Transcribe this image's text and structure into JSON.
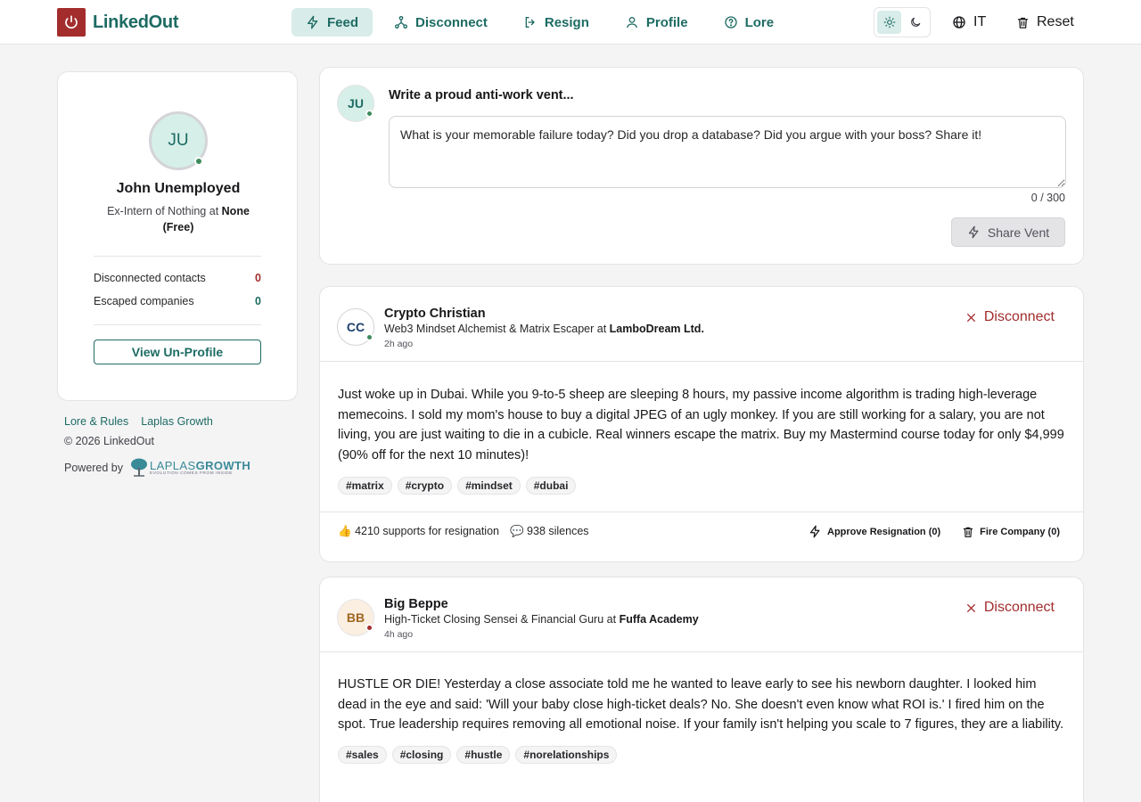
{
  "brand": {
    "name": "LinkedOut"
  },
  "nav": [
    {
      "label": "Feed",
      "icon": "bolt-icon",
      "active": true
    },
    {
      "label": "Disconnect",
      "icon": "network-icon"
    },
    {
      "label": "Resign",
      "icon": "logout-icon"
    },
    {
      "label": "Profile",
      "icon": "user-icon"
    },
    {
      "label": "Lore",
      "icon": "help-circle-icon"
    }
  ],
  "header": {
    "language": "IT",
    "reset": "Reset",
    "theme": "light"
  },
  "profile": {
    "initials": "JU",
    "name": "John Unemployed",
    "title_prefix": "Ex-Intern of Nothing at",
    "company": "None (Free)",
    "stats": [
      {
        "label": "Disconnected contacts",
        "value": "0",
        "color": "#a32d2d"
      },
      {
        "label": "Escaped companies",
        "value": "0",
        "color": "#1d6b63"
      }
    ],
    "view_button": "View Un-Profile"
  },
  "footer": {
    "links": [
      "Lore & Rules",
      "Laplas Growth"
    ],
    "copyright": "© 2026 LinkedOut",
    "powered_by": "Powered by",
    "partner": {
      "word_light": "LAPLAS",
      "word_bold": "GROWTH",
      "tagline": "EVOLUTION COMES FROM INSIDE"
    }
  },
  "composer": {
    "initials": "JU",
    "title": "Write a proud anti-work vent...",
    "placeholder": "What is your memorable failure today? Did you drop a database? Did you argue with your boss? Share it!",
    "counter": "0 / 300",
    "submit": "Share Vent"
  },
  "posts": [
    {
      "initials": "CC",
      "author": "Crypto Christian",
      "headline_prefix": "Web3 Mindset Alchemist & Matrix Escaper at",
      "company": "LamboDream Ltd.",
      "time": "2h ago",
      "disconnect": "Disconnect",
      "body": "Just woke up in Dubai. While you 9-to-5 sheep are sleeping 8 hours, my passive income algorithm is trading high-leverage memecoins. I sold my mom's house to buy a digital JPEG of an ugly monkey. If you are still working for a salary, you are not living, you are just waiting to die in a cubicle. Real winners escape the matrix. Buy my Mastermind course today for only $4,999 (90% off for the next 10 minutes)!",
      "tags": [
        "#matrix",
        "#crypto",
        "#mindset",
        "#dubai"
      ],
      "supports": "4210 supports for resignation",
      "silences": "938 silences",
      "approve": "Approve Resignation (0)",
      "fire": "Fire Company (0)"
    },
    {
      "initials": "BB",
      "author": "Big Beppe",
      "headline_prefix": "High-Ticket Closing Sensei & Financial Guru at",
      "company": "Fuffa Academy",
      "time": "4h ago",
      "disconnect": "Disconnect",
      "body": "HUSTLE OR DIE! Yesterday a close associate told me he wanted to leave early to see his newborn daughter. I looked him dead in the eye and said: 'Will your baby close high-ticket deals? No. She doesn't even know what ROI is.' I fired him on the spot. True leadership requires removing all emotional noise. If your family isn't helping you scale to 7 figures, they are a liability.",
      "tags": [
        "#sales",
        "#closing",
        "#hustle",
        "#norelationships"
      ]
    }
  ],
  "colors": {
    "brand": "#1d6b63",
    "danger": "#a32d2d",
    "accent_bg": "#d8ece9"
  }
}
